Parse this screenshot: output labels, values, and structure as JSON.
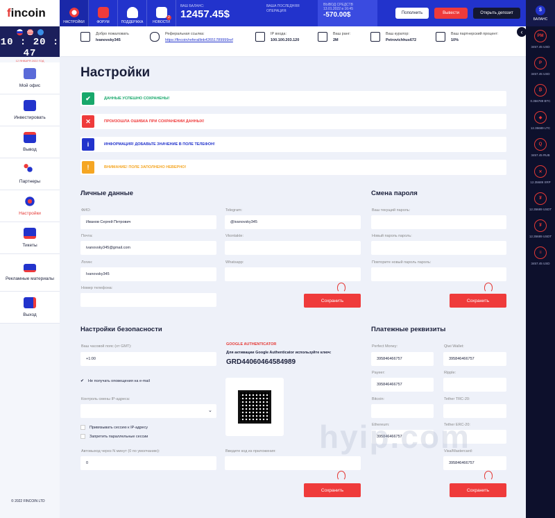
{
  "logo": {
    "accent": "f",
    "text": "incoin"
  },
  "nav": [
    {
      "label": "НАСТРОЙКИ",
      "icon": "gear-icon",
      "active": true
    },
    {
      "label": "ФОРУМ",
      "icon": "chat-icon"
    },
    {
      "label": "ПОДДЕРЖКА",
      "icon": "user-icon"
    },
    {
      "label": "НОВОСТИ",
      "icon": "news-icon",
      "badge": "2"
    }
  ],
  "balance": {
    "label": "ВАШ БАЛАНС:",
    "value": "12457.45$"
  },
  "last_op": {
    "label": "ВАША ПОСЛЕДНЯЯ ОПЕРАЦИЯ:",
    "title": "ВЫВОД СРЕДСТВ",
    "date": "13.01.2022 в 16:45",
    "value": "-570.00$"
  },
  "buttons": {
    "deposit": "Пополнить",
    "withdraw": "Вывести",
    "open_deposit": "Открыть депозит"
  },
  "clock": {
    "time": "10 : 20 : 47",
    "date": "12 ЯНВАРЯ 2022 ГОД"
  },
  "sidebar": [
    {
      "label": "Мой офис",
      "icon": "office-icon"
    },
    {
      "label": "Инвестировать",
      "icon": "invest-icon"
    },
    {
      "label": "Вывод",
      "icon": "wallet-icon"
    },
    {
      "label": "Партнеры",
      "icon": "partners-icon"
    },
    {
      "label": "Настройки",
      "icon": "settings-icon",
      "active": true
    },
    {
      "label": "Тикеты",
      "icon": "tickets-icon"
    },
    {
      "label": "Рекламные материалы",
      "icon": "promo-icon"
    },
    {
      "label": "Выход",
      "icon": "logout-icon"
    }
  ],
  "copyright": "© 2022 FINCOIN LTD",
  "info": {
    "welcome": {
      "label": "Добро пожаловать",
      "value": "Ivanovsky345"
    },
    "ref": {
      "label": "Реферальная ссылка:",
      "value": "https://fincoin/referallink42651789999ref"
    },
    "ip": {
      "label": "IP входа:",
      "value": "100.100.203.120"
    },
    "rank": {
      "label": "Ваш ранг:",
      "value": "2M"
    },
    "curator": {
      "label": "Ваш куратор:",
      "value": "Petrovichhus672"
    },
    "percent": {
      "label": "Ваш партнерский процент:",
      "value": "10%"
    }
  },
  "page_title": "Настройки",
  "alerts": [
    {
      "text": "ДАННЫЕ УСПЕШНО СОХРАНЕНЫ!",
      "icon": "✔",
      "color": "#18a86b",
      "type": "success"
    },
    {
      "text": "ПРОИЗОШЛА ОШИБКА ПРИ СОХРАНЕНИИ ДАННЫХ!",
      "icon": "✕",
      "color": "#ef3b3b",
      "type": "error"
    },
    {
      "text": "ИНФОРМАЦИЯ! ДОБАВЬТЕ ЗНАЧЕНИЕ В ПОЛЕ ТЕЛЕФОН!",
      "icon": "i",
      "color": "#2233cc",
      "type": "info"
    },
    {
      "text": "ВНИМАНИЕ! ПОЛЕ ЗАПОЛНЕНО НЕВЕРНО!",
      "icon": "!",
      "color": "#f5a623",
      "type": "warning"
    }
  ],
  "personal": {
    "title": "Личные данные",
    "fio": {
      "label": "ФИО:",
      "value": "Иванов Сергей Петрович"
    },
    "telegram": {
      "label": "Telegram:",
      "value": "@ivanovsky345"
    },
    "email": {
      "label": "Почта:",
      "value": "ivanovsky345@gmail.com"
    },
    "vk": {
      "label": "Vkontakte:",
      "value": ""
    },
    "login": {
      "label": "Логин:",
      "value": "Ivanovsky345"
    },
    "whatsapp": {
      "label": "Whatsapp:",
      "value": ""
    },
    "phone": {
      "label": "Номер телефона:",
      "value": ""
    },
    "save": "Сохранить"
  },
  "password": {
    "title": "Смена пароля",
    "current": "Ваш текущий пароль:",
    "new": "Новый пароль пароль:",
    "repeat": "Повторите новый пароль пароль:",
    "save": "Сохранить"
  },
  "security": {
    "title": "Настройки безопасности",
    "tz": {
      "label": "Ваш часовой пояс (от GMT):",
      "value": "+1:00"
    },
    "no_email": "Не получать оповещения на e-mail",
    "ip_control": {
      "label": "Контроль смены IP-адреса:",
      "value": ""
    },
    "bind_ip": "Привязывать сессию к IP-адресу",
    "no_parallel": "Запретить параллельные сессии",
    "autologout": {
      "label": "Автовыход через N минут (0 по умолчанию):",
      "value": "0"
    },
    "ga_title": "GOOGLE AUTHENTICATOR",
    "ga_text": "Для активации Google Authenticator используйте ключ:",
    "ga_key": "GRD44060464584989",
    "code": {
      "label": "Введите код из приложения:",
      "value": ""
    },
    "save": "Сохранить"
  },
  "payment": {
    "title": "Платежные реквизиты",
    "pm": {
      "label": "Perfect Money:",
      "value": "395846466757"
    },
    "qiwi": {
      "label": "Qiwi Wallet:",
      "value": "395846466757"
    },
    "payeer": {
      "label": "Payeer:",
      "value": "395846466757"
    },
    "ripple": {
      "label": "Ripple:",
      "value": ""
    },
    "bitcoin": {
      "label": "Bitcoin:",
      "value": ""
    },
    "trc20": {
      "label": "Tether TRC-20:",
      "value": ""
    },
    "eth": {
      "label": "Ethereum:",
      "value": "395846466757"
    },
    "erc20": {
      "label": "Tether ERC-20:",
      "value": ""
    },
    "visa": {
      "label": "Visa/Mastercard:",
      "value": "395846466757"
    },
    "save": "Сохранить"
  },
  "right": {
    "title": "БАЛАНС",
    "coins": [
      {
        "sym": "PM",
        "value": "3457.45 USD"
      },
      {
        "sym": "P",
        "value": "3457.45 USD"
      },
      {
        "sym": "₿",
        "value": "0.356789 BTC"
      },
      {
        "sym": "◆",
        "value": "12.35689 LTC"
      },
      {
        "sym": "Q",
        "value": "3457.45 RUB"
      },
      {
        "sym": "✕",
        "value": "12.35689 XRP"
      },
      {
        "sym": "₮",
        "value": "12.35689 USDT"
      },
      {
        "sym": "₮",
        "value": "12.35689 USDT"
      },
      {
        "sym": "≡",
        "value": "3457.45 USD"
      }
    ]
  },
  "watermark": "hyip.com"
}
